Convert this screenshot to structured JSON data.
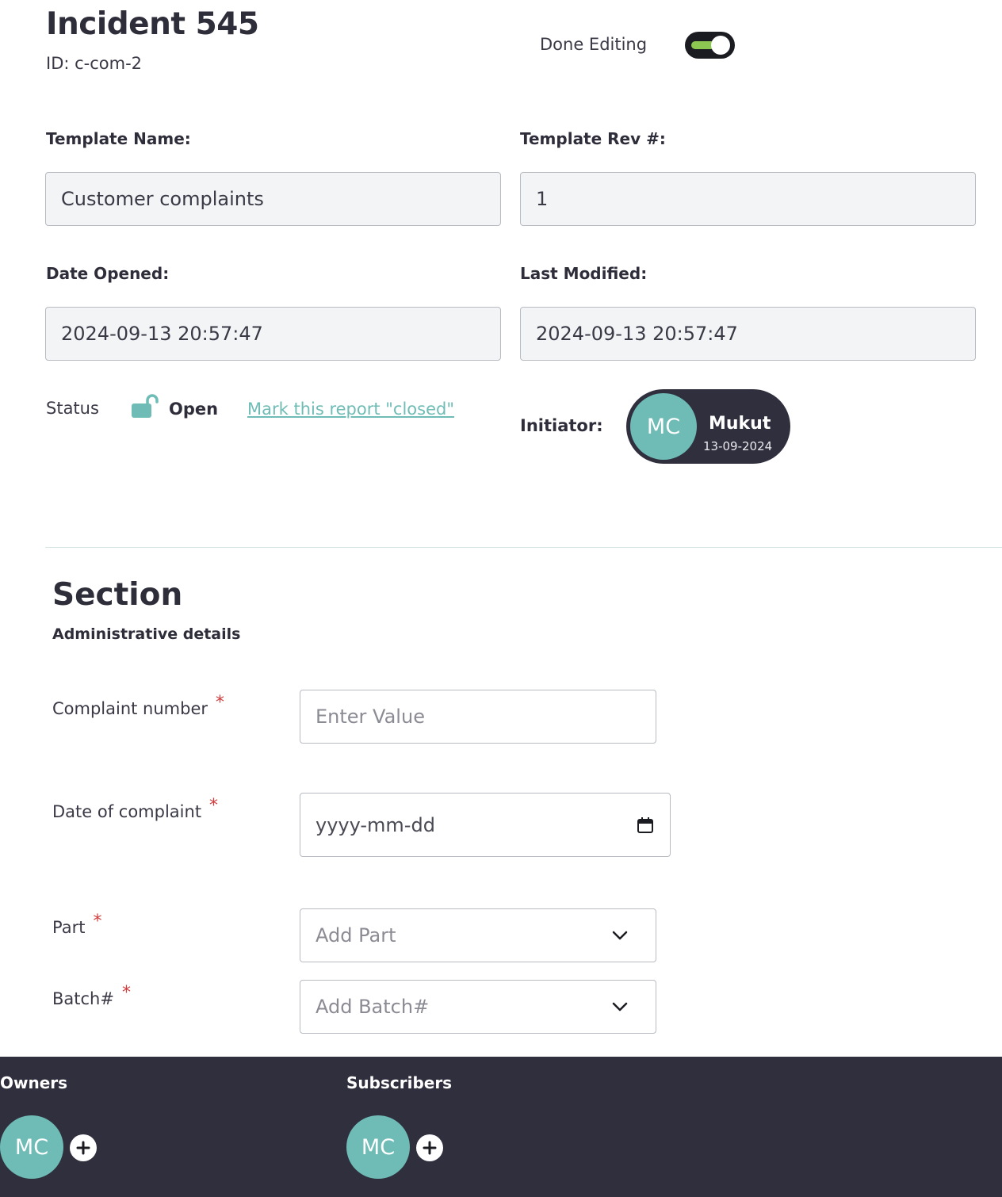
{
  "header": {
    "title": "Incident 545",
    "id_text": "ID: c-com-2",
    "done_editing_label": "Done Editing",
    "done_editing_on": true
  },
  "fields": {
    "template_name_label": "Template Name:",
    "template_name_value": "Customer complaints",
    "template_rev_label": "Template Rev #:",
    "template_rev_value": "1",
    "date_opened_label": "Date Opened:",
    "date_opened_value": "2024-09-13 20:57:47",
    "last_modified_label": "Last Modified:",
    "last_modified_value": "2024-09-13 20:57:47"
  },
  "status": {
    "label": "Status",
    "value": "Open",
    "action_link": "Mark this report \"closed\""
  },
  "initiator": {
    "label": "Initiator:",
    "initials": "MC",
    "name": "Mukut",
    "date": "13-09-2024"
  },
  "section": {
    "title": "Section",
    "subtitle": "Administrative details",
    "required_mark": "*",
    "questions": {
      "complaint_number": {
        "label": "Complaint number",
        "placeholder": "Enter Value"
      },
      "date_of_complaint": {
        "label": "Date of complaint",
        "placeholder": "yyyy-mm-dd"
      },
      "part": {
        "label": "Part",
        "placeholder": "Add Part"
      },
      "batch": {
        "label": "Batch#",
        "placeholder": "Add Batch#"
      }
    }
  },
  "footer": {
    "owners_label": "Owners",
    "owners": [
      {
        "initials": "MC"
      }
    ],
    "subscribers_label": "Subscribers",
    "subscribers": [
      {
        "initials": "MC"
      }
    ]
  },
  "colors": {
    "accent_teal": "#6fbcb6",
    "dark": "#302f3e",
    "toggle_green": "#8cc751",
    "required_red": "#d23c3c"
  },
  "icons": {
    "status": "unlocked-padlock-icon",
    "date": "calendar-icon",
    "dropdown": "chevron-down-icon",
    "add": "plus-icon"
  }
}
